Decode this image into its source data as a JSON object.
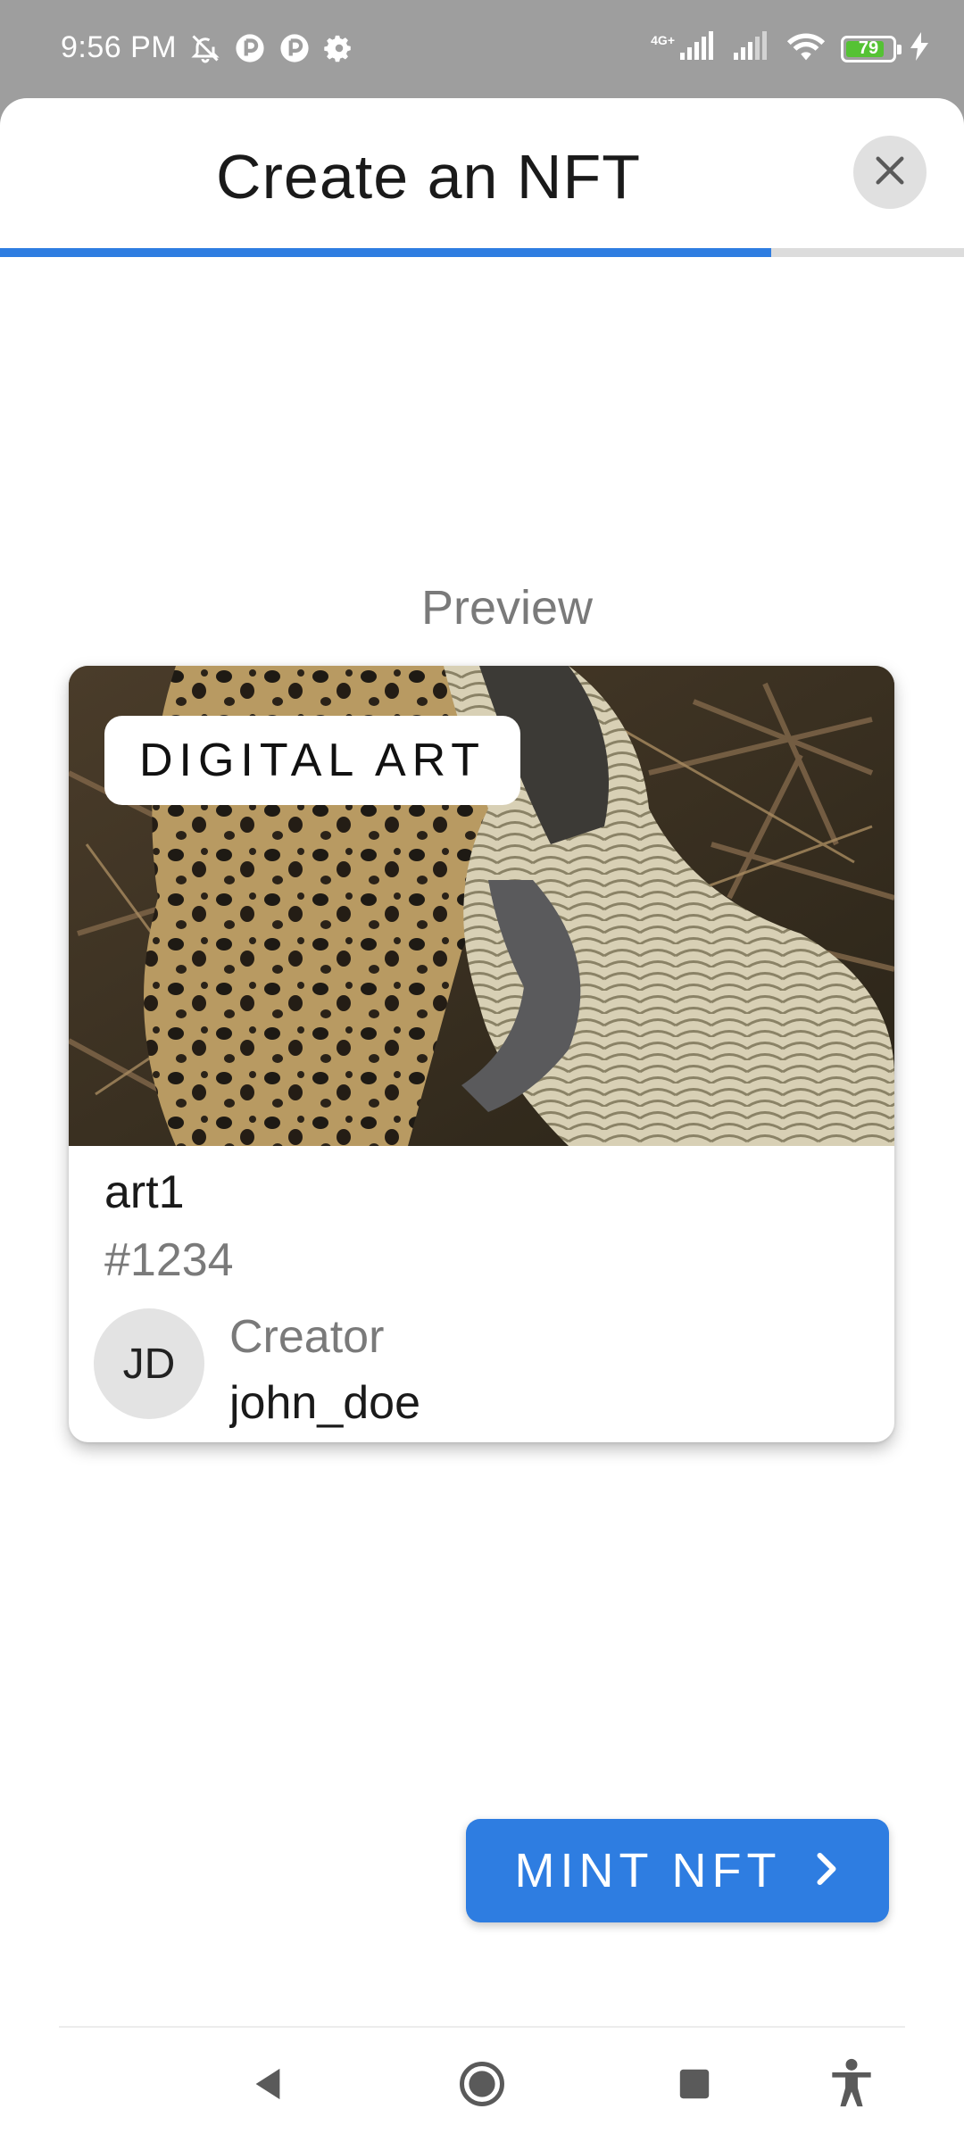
{
  "status_bar": {
    "time": "9:56 PM",
    "battery": "79",
    "network_label": "4G+",
    "icons": [
      "bell-off-icon",
      "app-icon",
      "app-icon",
      "settings-icon",
      "signal-icon",
      "signal-icon",
      "wifi-icon",
      "battery-icon",
      "charging-icon"
    ]
  },
  "sheet": {
    "title": "Create an NFT",
    "close_icon": "close-icon",
    "progress": 0.8,
    "accent_color": "#2e7de1"
  },
  "preview": {
    "label": "Preview",
    "category": "DIGITAL ART",
    "name": "art1",
    "token_id": "#1234",
    "avatar_initials": "JD",
    "creator_label": "Creator",
    "creator_name": "john_doe"
  },
  "actions": {
    "mint_label": "MINT NFT",
    "mint_icon": "chevron-right-icon"
  },
  "nav": {
    "items": [
      "back-icon",
      "home-icon",
      "recents-icon",
      "accessibility-icon"
    ]
  }
}
